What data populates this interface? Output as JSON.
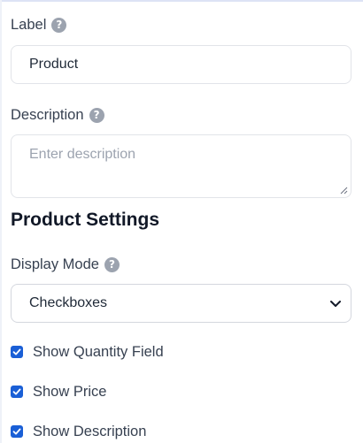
{
  "label_field": {
    "label": "Label",
    "help_icon": "question-circle-icon",
    "value": "Product"
  },
  "description_field": {
    "label": "Description",
    "help_icon": "question-circle-icon",
    "placeholder": "Enter description"
  },
  "section": {
    "title": "Product Settings"
  },
  "display_mode": {
    "label": "Display Mode",
    "help_icon": "question-circle-icon",
    "selected": "Checkboxes"
  },
  "options": [
    {
      "label": "Show Quantity Field",
      "checked": true
    },
    {
      "label": "Show Price",
      "checked": true
    },
    {
      "label": "Show Description",
      "checked": true
    }
  ],
  "colors": {
    "accent": "#1a5fd6",
    "help_icon": "#9ca3af",
    "border": "#e2e4e9"
  }
}
